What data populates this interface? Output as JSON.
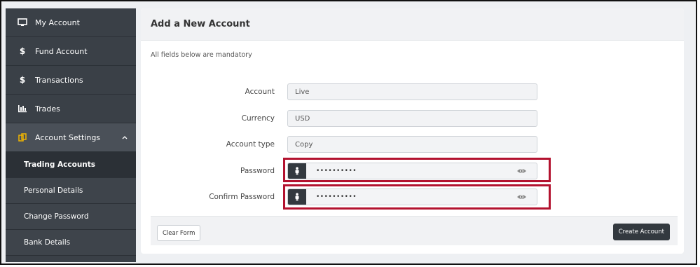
{
  "sidebar": {
    "items": [
      {
        "label": "My Account",
        "icon": "monitor-icon"
      },
      {
        "label": "Fund Account",
        "icon": "dollar-icon"
      },
      {
        "label": "Transactions",
        "icon": "dollar-icon"
      },
      {
        "label": "Trades",
        "icon": "bar-chart-icon"
      },
      {
        "label": "Account Settings",
        "icon": "settings-icon",
        "expanded": true
      }
    ],
    "subitems": [
      {
        "label": "Trading Accounts",
        "current": true
      },
      {
        "label": "Personal Details"
      },
      {
        "label": "Change Password"
      },
      {
        "label": "Bank Details"
      }
    ]
  },
  "panel": {
    "title": "Add a New Account",
    "note": "All fields below are mandatory",
    "fields": {
      "account": {
        "label": "Account",
        "value": "Live"
      },
      "currency": {
        "label": "Currency",
        "value": "USD"
      },
      "account_type": {
        "label": "Account type",
        "value": "Copy"
      },
      "password": {
        "label": "Password",
        "value": "••••••••••"
      },
      "confirm_password": {
        "label": "Confirm Password",
        "value": "••••••••••"
      }
    },
    "buttons": {
      "clear": "Clear Form",
      "create": "Create Account"
    }
  },
  "colors": {
    "sidebar_bg": "#3a4047",
    "highlight": "#b3122f",
    "primary_button": "#33393f"
  }
}
